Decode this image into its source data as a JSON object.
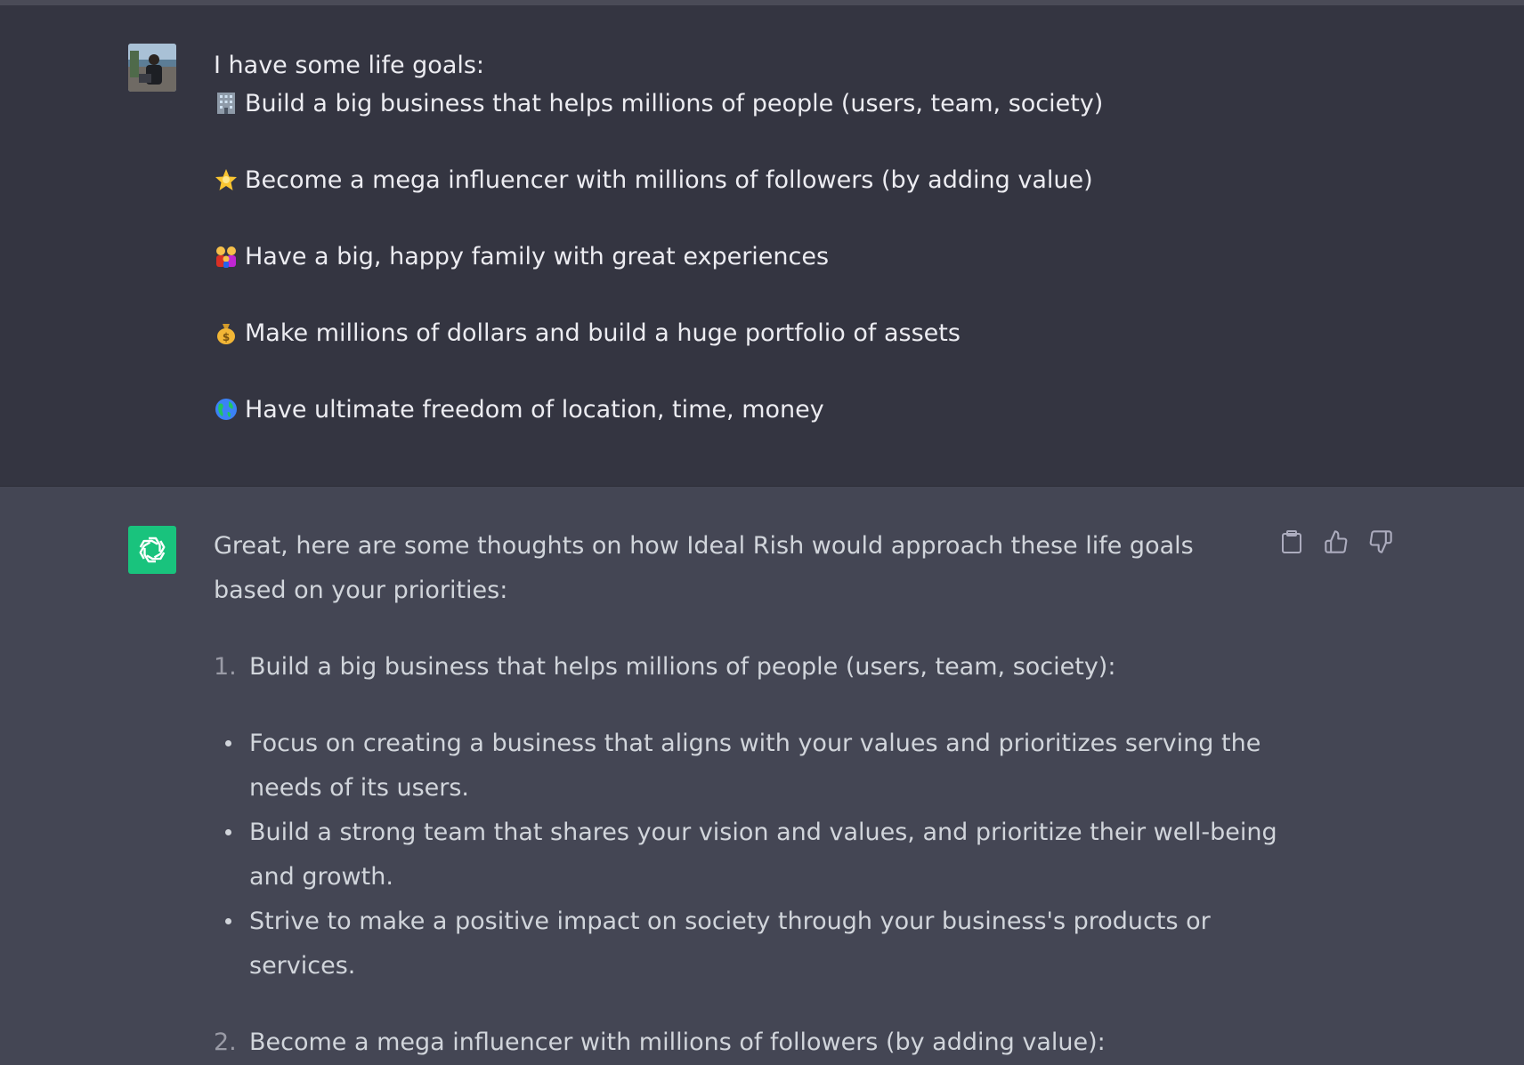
{
  "user_message": {
    "intro": "I have some life goals:",
    "goals": [
      {
        "icon": "office-building-emoji",
        "text": "Build a big business that helps millions of people (users, team, society)"
      },
      {
        "icon": "glowing-star-emoji",
        "text": "Become a mega influencer with millions of followers (by adding value)"
      },
      {
        "icon": "family-emoji",
        "text": "Have a big, happy family with great experiences"
      },
      {
        "icon": "money-bag-emoji",
        "text": "Make millions of dollars and build a huge portfolio of assets"
      },
      {
        "icon": "globe-emoji",
        "text": "Have ultimate freedom of location, time, money"
      }
    ]
  },
  "assistant_message": {
    "intro": "Great, here are some thoughts on how Ideal Rish would approach these life goals based on your priorities:",
    "items": [
      {
        "number": "1.",
        "title": "Build a big business that helps millions of people (users, team, society):",
        "bullets": [
          "Focus on creating a business that aligns with your values and prioritizes serving the needs of its users.",
          "Build a strong team that shares your vision and values, and prioritize their well-being and growth.",
          "Strive to make a positive impact on society through your business's products or services."
        ]
      },
      {
        "number": "2.",
        "title": "Become a mega influencer with millions of followers (by adding value):"
      }
    ],
    "actions": [
      "copy-icon",
      "thumbs-up-icon",
      "thumbs-down-icon"
    ]
  },
  "colors": {
    "user_bg": "#343541",
    "assistant_bg": "#444654",
    "bot_avatar": "#19c37d"
  }
}
